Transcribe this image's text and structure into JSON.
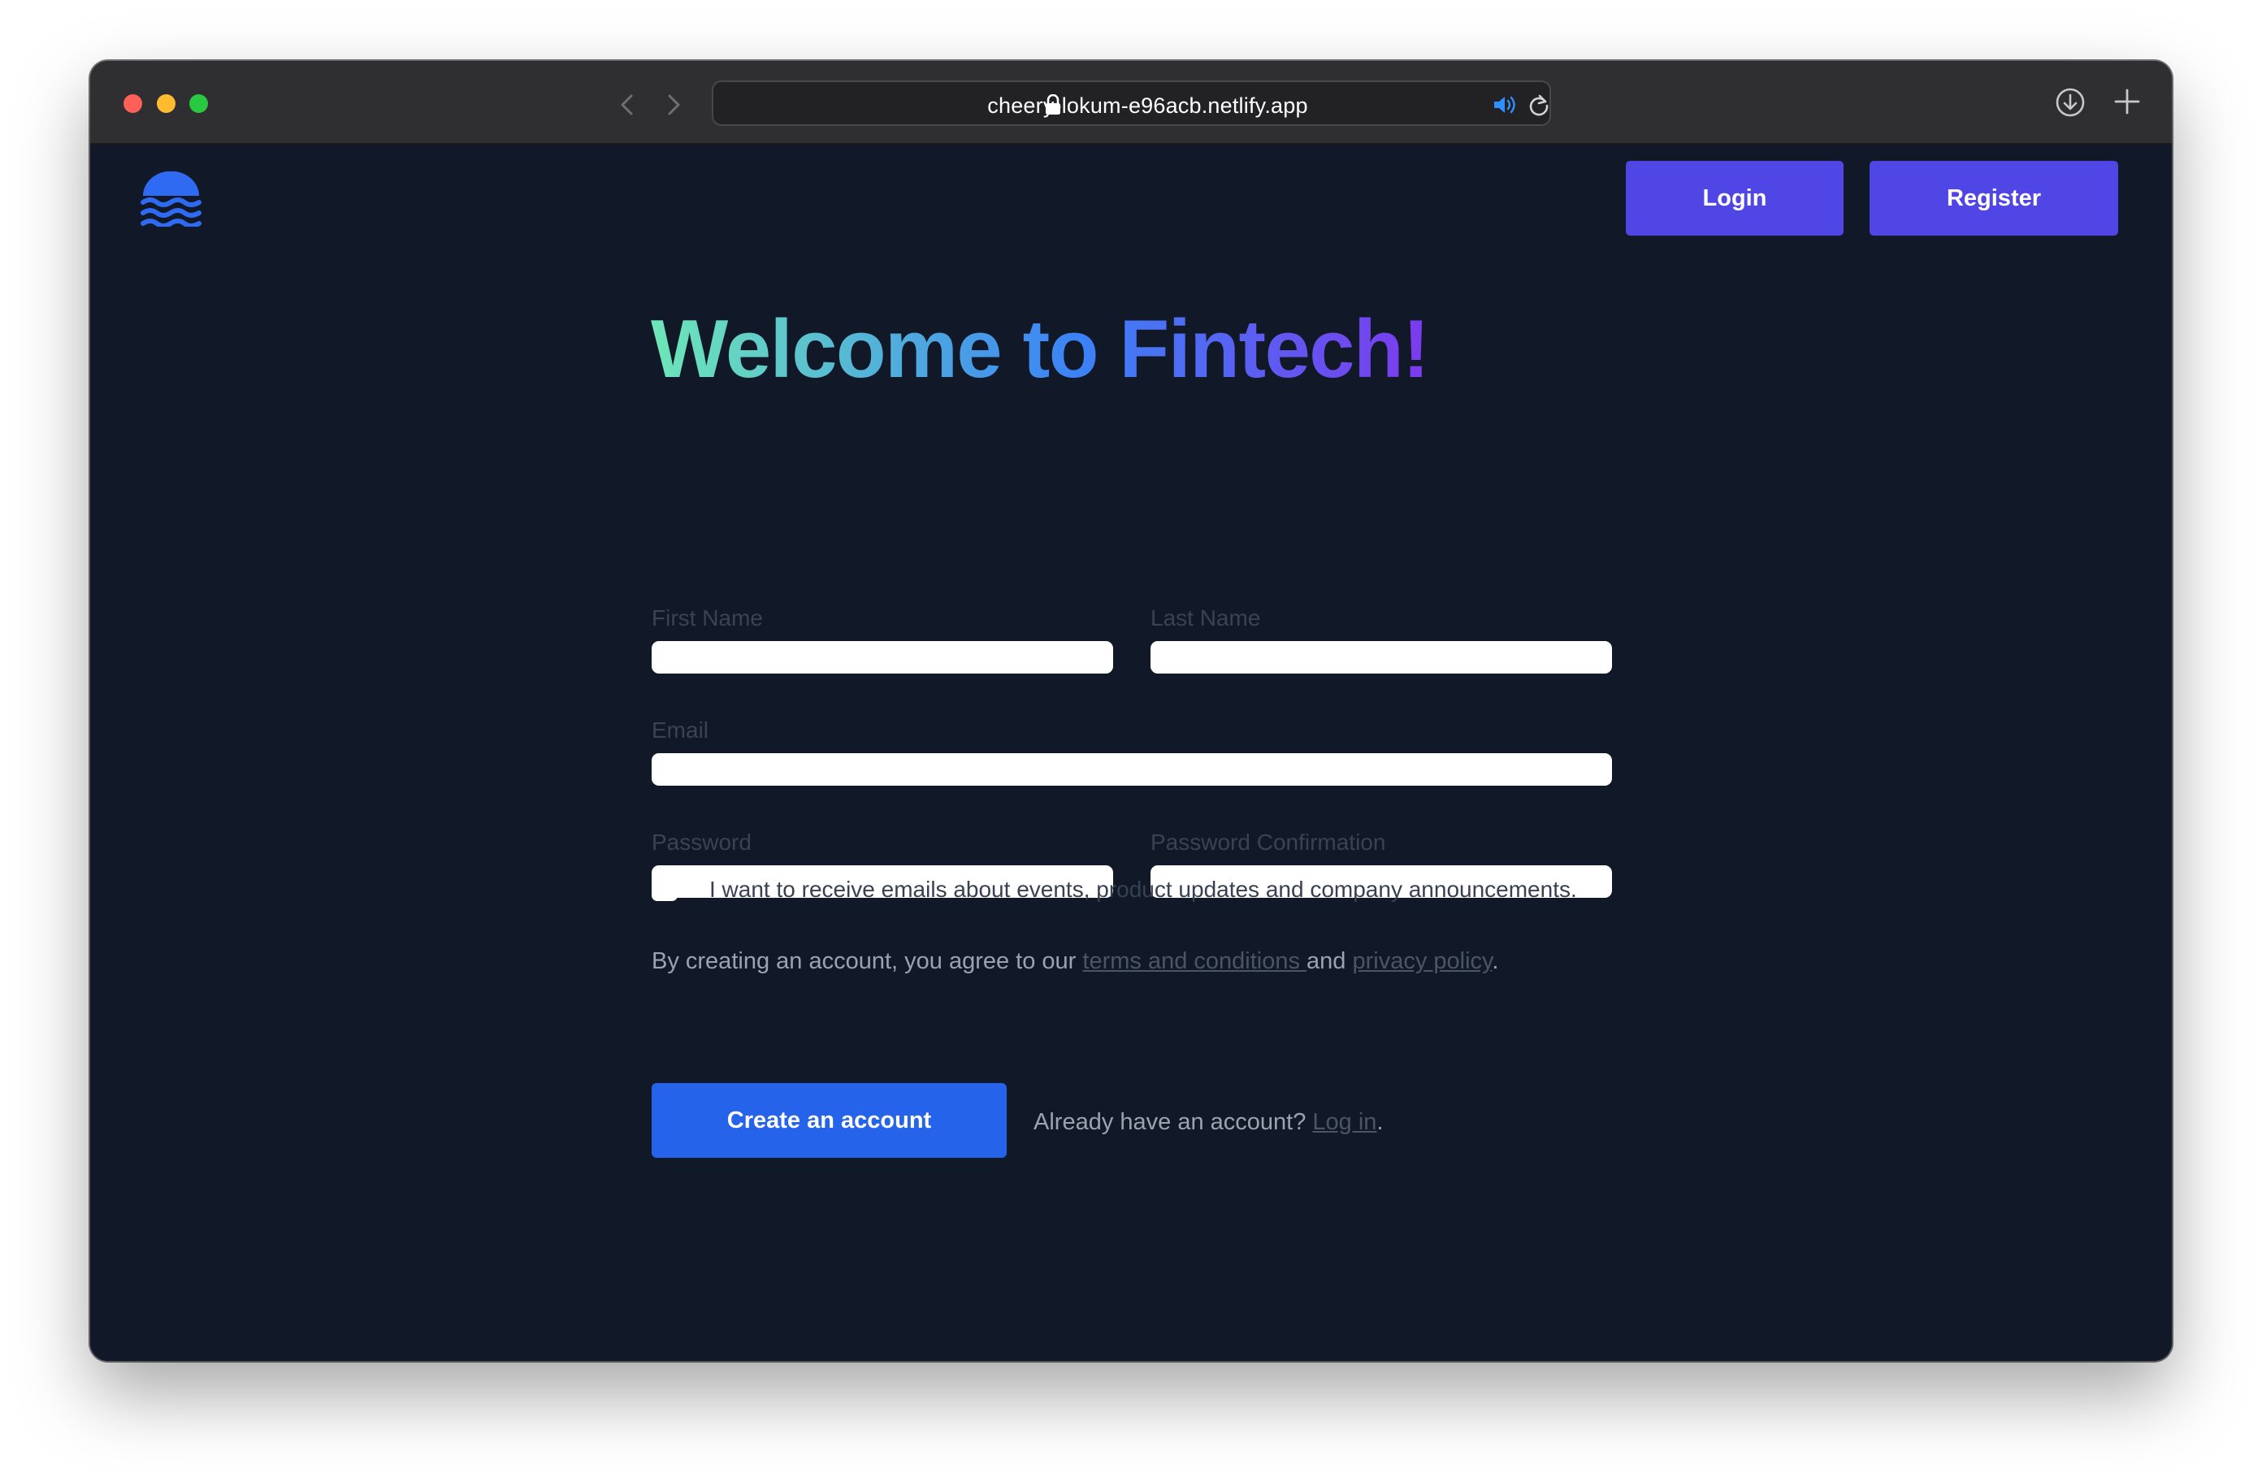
{
  "browser": {
    "url": "cheery-lokum-e96acb.netlify.app",
    "icons": [
      "close-light",
      "minimize-light",
      "zoom-light",
      "back-icon",
      "forward-icon",
      "lock-icon",
      "speaker-icon",
      "reload-icon",
      "download-icon",
      "new-tab-icon"
    ]
  },
  "header": {
    "logo": "waves-logo",
    "login_label": "Login",
    "register_label": "Register"
  },
  "form": {
    "title": "Welcome to Fintech!",
    "first_name_label": "First Name",
    "last_name_label": "Last Name",
    "email_label": "Email",
    "password_label": "Password",
    "password_confirmation_label": "Password Confirmation",
    "first_name_value": "",
    "last_name_value": "",
    "email_value": "",
    "password_value": "",
    "password_confirmation_value": "",
    "marketing_label": "I want to receive emails about events, product updates and company announcements.",
    "marketing_checked": false,
    "terms_prefix": "By creating an account, you agree to our ",
    "terms_link": "terms and conditions ",
    "terms_middle": "and ",
    "privacy_link": "privacy policy",
    "terms_suffix": ".",
    "create_label": "Create an account",
    "already_prefix": "Already have an account? ",
    "login_link": "Log in",
    "already_suffix": "."
  },
  "colors": {
    "page_background": "#111827",
    "primary_button": "#4f46e5",
    "create_button": "#2563eb",
    "title_gradient": [
      "#6ee7b7",
      "#3b82f6",
      "#7c3aed"
    ]
  }
}
